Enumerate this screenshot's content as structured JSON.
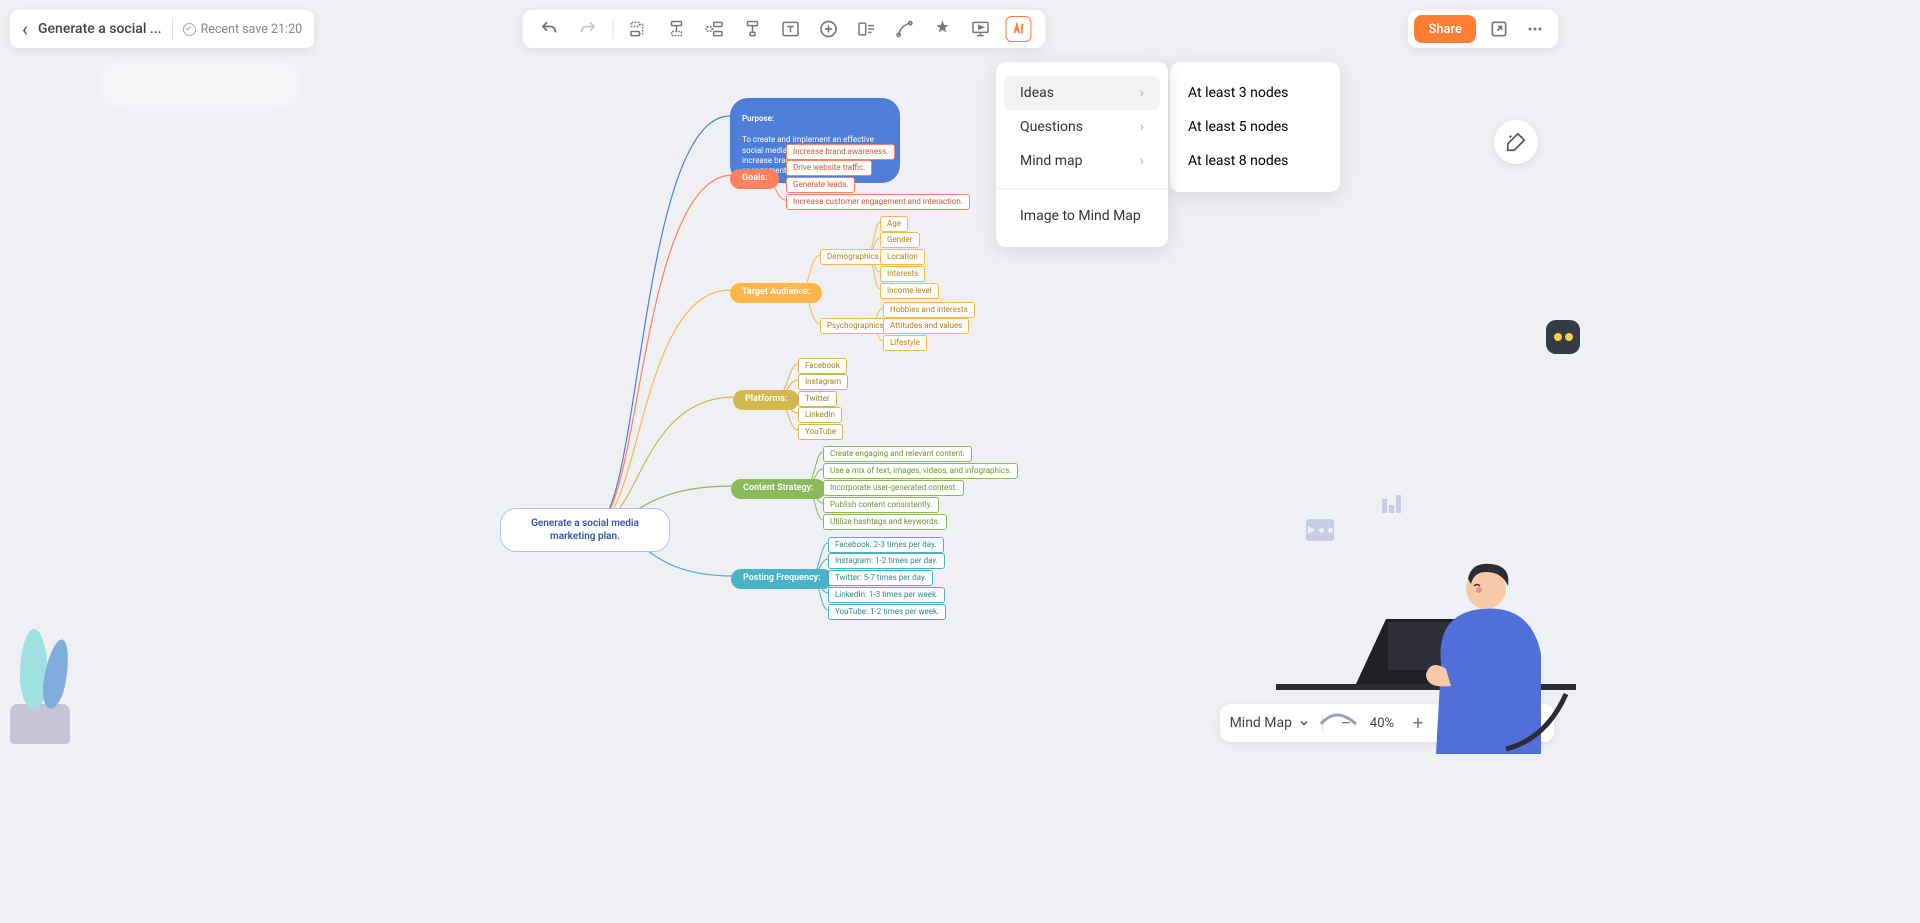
{
  "header": {
    "title": "Generate a social ...",
    "save_label": "Recent save 21:20",
    "share_label": "Share"
  },
  "menu": {
    "ideas": "Ideas",
    "questions": "Questions",
    "mindmap": "Mind map",
    "image_to_mm": "Image to Mind Map",
    "sub": {
      "n3": "At least 3 nodes",
      "n5": "At least 5 nodes",
      "n8": "At least 8 nodes"
    }
  },
  "bottom": {
    "view_mode": "Mind Map",
    "zoom": "40%"
  },
  "mindmap": {
    "root": "Generate a social media\nmarketing plan.",
    "purpose": {
      "label": "Purpose:",
      "text": "To create and implement an effective social media marketing strategy to increase brand awareness and drive engagement."
    },
    "goals": {
      "label": "Goals:",
      "items": [
        "Increase brand awareness.",
        "Drive website traffic.",
        "Generate leads.",
        "Increase customer engagement and interaction."
      ]
    },
    "target": {
      "label": "Target Audience:",
      "demographics": {
        "label": "Demographics",
        "items": [
          "Age",
          "Gender",
          "Location",
          "Interests",
          "Income level"
        ]
      },
      "psychographics": {
        "label": "Psychographics",
        "items": [
          "Hobbies and interests",
          "Attitudes and values",
          "Lifestyle"
        ]
      }
    },
    "platforms": {
      "label": "Platforms:",
      "items": [
        "Facebook",
        "Instagram",
        "Twitter",
        "LinkedIn",
        "YouTube"
      ]
    },
    "content": {
      "label": "Content Strategy:",
      "items": [
        "Create engaging and relevant content.",
        "Use a mix of text, images, videos, and infographics.",
        "Incorporate user-generated content.",
        "Publish content consistently.",
        "Utilize hashtags and keywords."
      ]
    },
    "posting": {
      "label": "Posting Frequency:",
      "items": [
        "Facebook: 2-3 times per day.",
        "Instagram: 1-2 times per day.",
        "Twitter: 5-7 times per day.",
        "LinkedIn: 1-3 times per week.",
        "YouTube: 1-2 times per week."
      ]
    }
  }
}
